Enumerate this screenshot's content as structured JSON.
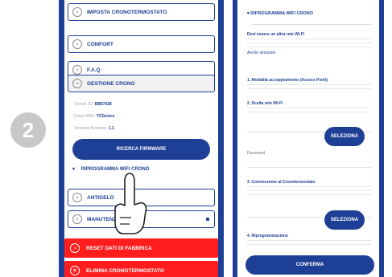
{
  "step_number": "2",
  "left_panel": {
    "menu_items": [
      {
        "label": "IMPOSTA CRONOTERMOSTATO"
      },
      {
        "label": "COMFORT"
      },
      {
        "label": "F.A.Q"
      },
      {
        "label": "GESTIONE CRONO"
      }
    ],
    "info": {
      "line1_label": "Cronot. ID:",
      "line1_value": "BB87028",
      "line2_label": "Crono WiFi:",
      "line2_value": "TCDevice",
      "line3_label": "Versione firmware:",
      "line3_value": "1.1"
    },
    "search_firmware_label": "RICERCA FIRMWARE",
    "expander_label": "RIPROGRAMMA WIFI CRONO",
    "lower_items": [
      {
        "label": "ANTIGELO"
      },
      {
        "label": "MANUTENZIONE"
      }
    ],
    "danger_buttons": [
      {
        "label": "RESET DATI DI FABBRICA"
      },
      {
        "label": "ELIMINA CRONOTERMOSTATO"
      }
    ]
  },
  "right_panel": {
    "header_label": "RIPROGRAMMA WIFI CRONO",
    "section_title": "Devi essere un altra rete Wi-Fi",
    "section_note": "Anche istruzioni",
    "step1_title": "1. Modalità accoppiamento (Access Point)",
    "step2_title": "2. Scelta rete Wi-Fi",
    "select_label_1": "SELEZIONA",
    "password_label": "Password",
    "step3_title": "3. Connessione al Cronotermostato",
    "select_label_2": "SELEZIONA",
    "step4_title": "4. Riprogrammazione",
    "confirm_label": "CONFERMA"
  },
  "colors": {
    "brand_blue": "#1e3f96",
    "danger_red": "#ff1d1d",
    "step_grey": "#c8c8c8"
  }
}
